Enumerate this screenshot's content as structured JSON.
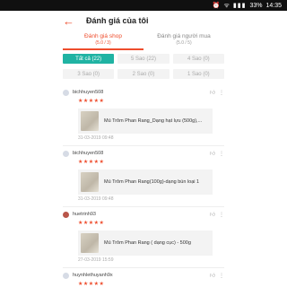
{
  "status_bar": {
    "battery": "33%",
    "time": "14:35",
    "icons": "⏰ ᯤ ▮▮▮"
  },
  "header": {
    "title": "Đánh giá của tôi"
  },
  "tabs": [
    {
      "label": "Đánh giá shop",
      "count": "(5.0 / 3)"
    },
    {
      "label": "Đánh giá người mua",
      "count": "(5.0 / 5)"
    }
  ],
  "filters": {
    "row1": [
      "Tất cả (22)",
      "5 Sao (22)",
      "4 Sao (0)"
    ],
    "row2": [
      "3 Sao (0)",
      "2 Sao (0)",
      "1 Sao (0)"
    ],
    "active": "Tất cả (22)"
  },
  "reviews": [
    {
      "user": "bichhuyen508",
      "stars": "★★★★★",
      "product": "Mủ Trôm Phan Rang_Dạng hạt lựu (500g),...",
      "date": "31-03-2019 09:48"
    },
    {
      "user": "bichhuyen508",
      "stars": "★★★★★",
      "product": "Mủ Trôm Phan Rang(100g)-dạng bún loại 1",
      "date": "31-03-2019 09:48"
    },
    {
      "user": "huetrinh93",
      "stars": "★★★★★",
      "product": "Mủ Trôm Phan Rang ( dạng cục) - 500g",
      "date": "27-03-2019 15:59"
    },
    {
      "user": "huynhlethuyanh9x",
      "stars": "★★★★★",
      "product": "",
      "date": ""
    }
  ],
  "icons": {
    "back": "arrow-left-icon",
    "like": "thumbs-up-icon",
    "more": "more-vertical-icon"
  },
  "colors": {
    "accent": "#ee4d2d",
    "chip_active": "#20b3a3"
  }
}
